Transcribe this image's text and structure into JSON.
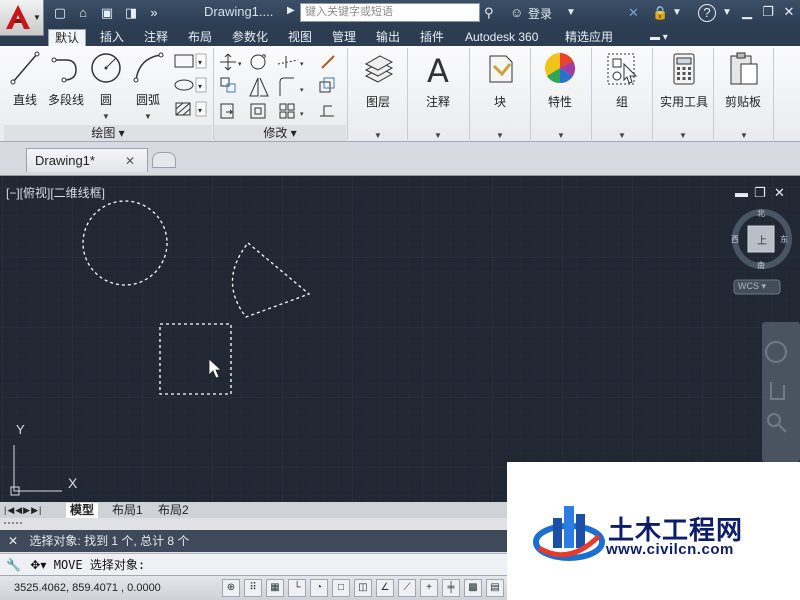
{
  "title_bar": {
    "document_title": "Drawing1....",
    "search_placeholder": "键入关键字或短语",
    "login_label": "登录",
    "help_label": "?",
    "quick_access": [
      "new-icon",
      "open-icon",
      "save-icon",
      "saveas-icon",
      "more-icon"
    ]
  },
  "ribbon_tabs": [
    "默认",
    "插入",
    "注释",
    "布局",
    "参数化",
    "视图",
    "管理",
    "输出",
    "插件",
    "Autodesk 360",
    "精选应用"
  ],
  "active_tab": "默认",
  "panels": {
    "draw": {
      "title": "绘图 ▾",
      "tools": [
        "直线",
        "多段线",
        "圆",
        "圆弧"
      ]
    },
    "modify": {
      "title": "修改 ▾"
    },
    "tools": [
      {
        "label": "图层"
      },
      {
        "label": "注释"
      },
      {
        "label": "块"
      },
      {
        "label": "特性"
      },
      {
        "label": "组"
      },
      {
        "label": "实用工具"
      },
      {
        "label": "剪贴板"
      }
    ]
  },
  "doc_tab": {
    "label": "Drawing1*",
    "close": "✕"
  },
  "viewport": {
    "label": "[−][俯视][二维线框]",
    "viewcube": {
      "north": "北",
      "south": "南",
      "east": "东",
      "west": "西",
      "face": "上",
      "wcs": "WCS ▾"
    },
    "ucs": {
      "x": "X",
      "y": "Y"
    }
  },
  "layout_tabs": [
    "模型",
    "布局1",
    "布局2"
  ],
  "command": {
    "history": "选择对象: 找到 1 个, 总计 8 个",
    "prompt": "MOVE 选择对象:"
  },
  "status_bar": {
    "coordinates": "3525.4062, 859.4071 , 0.0000"
  },
  "watermark": {
    "name": "土木工程网",
    "url": "www.civilcn.com"
  },
  "colors": {
    "accent": "#2c3d52",
    "canvas": "#212834",
    "grid": "#2b3442",
    "selection": "#ffffff"
  }
}
